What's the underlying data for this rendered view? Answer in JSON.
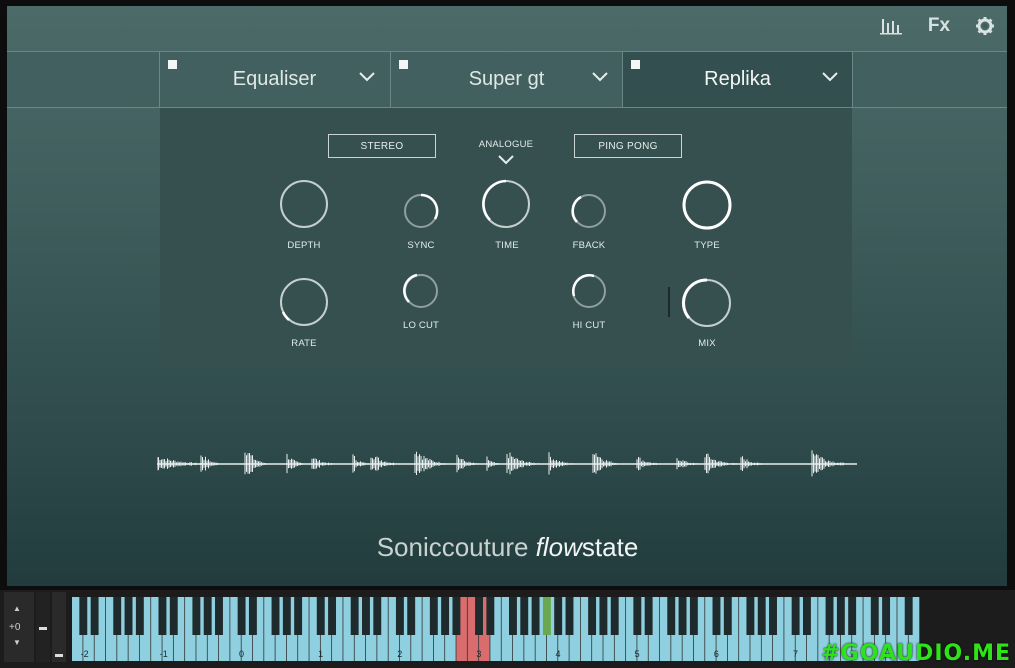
{
  "toolbar": {
    "icons": [
      {
        "name": "mixer-icon",
        "symbol": "|||"
      },
      {
        "name": "fx-icon",
        "label": "Fx"
      },
      {
        "name": "gear-icon",
        "symbol": "⚙"
      }
    ]
  },
  "tabs": [
    {
      "label": "Equaliser",
      "active": false
    },
    {
      "label": "Super gt",
      "active": false
    },
    {
      "label": "Replika",
      "active": true
    }
  ],
  "fx": {
    "stereo_label": "STEREO",
    "mode_label": "ANALOGUE",
    "pingpong_label": "PING PONG",
    "knobs": {
      "depth": "DEPTH",
      "sync": "SYNC",
      "time": "TIME",
      "fback": "FBACK",
      "type": "TYPE",
      "rate": "RATE",
      "locut": "LO CUT",
      "hicut": "HI CUT",
      "mix": "MIX"
    }
  },
  "brand": {
    "part1": "Soniccouture ",
    "part2": "flow",
    "part3": "state"
  },
  "keyboard": {
    "transpose": "+0",
    "octave_labels": [
      "-2",
      "-1",
      "0",
      "1",
      "2",
      "3",
      "4",
      "5",
      "6",
      "7"
    ]
  },
  "watermark": "#GOAUDIO.ME",
  "colors": {
    "panel": "#3f5d5c",
    "key_white": "#8fd0e0",
    "key_highlight": "#d96c6c",
    "key_marker": "#6aa84f",
    "watermark": "#2ee31a"
  }
}
